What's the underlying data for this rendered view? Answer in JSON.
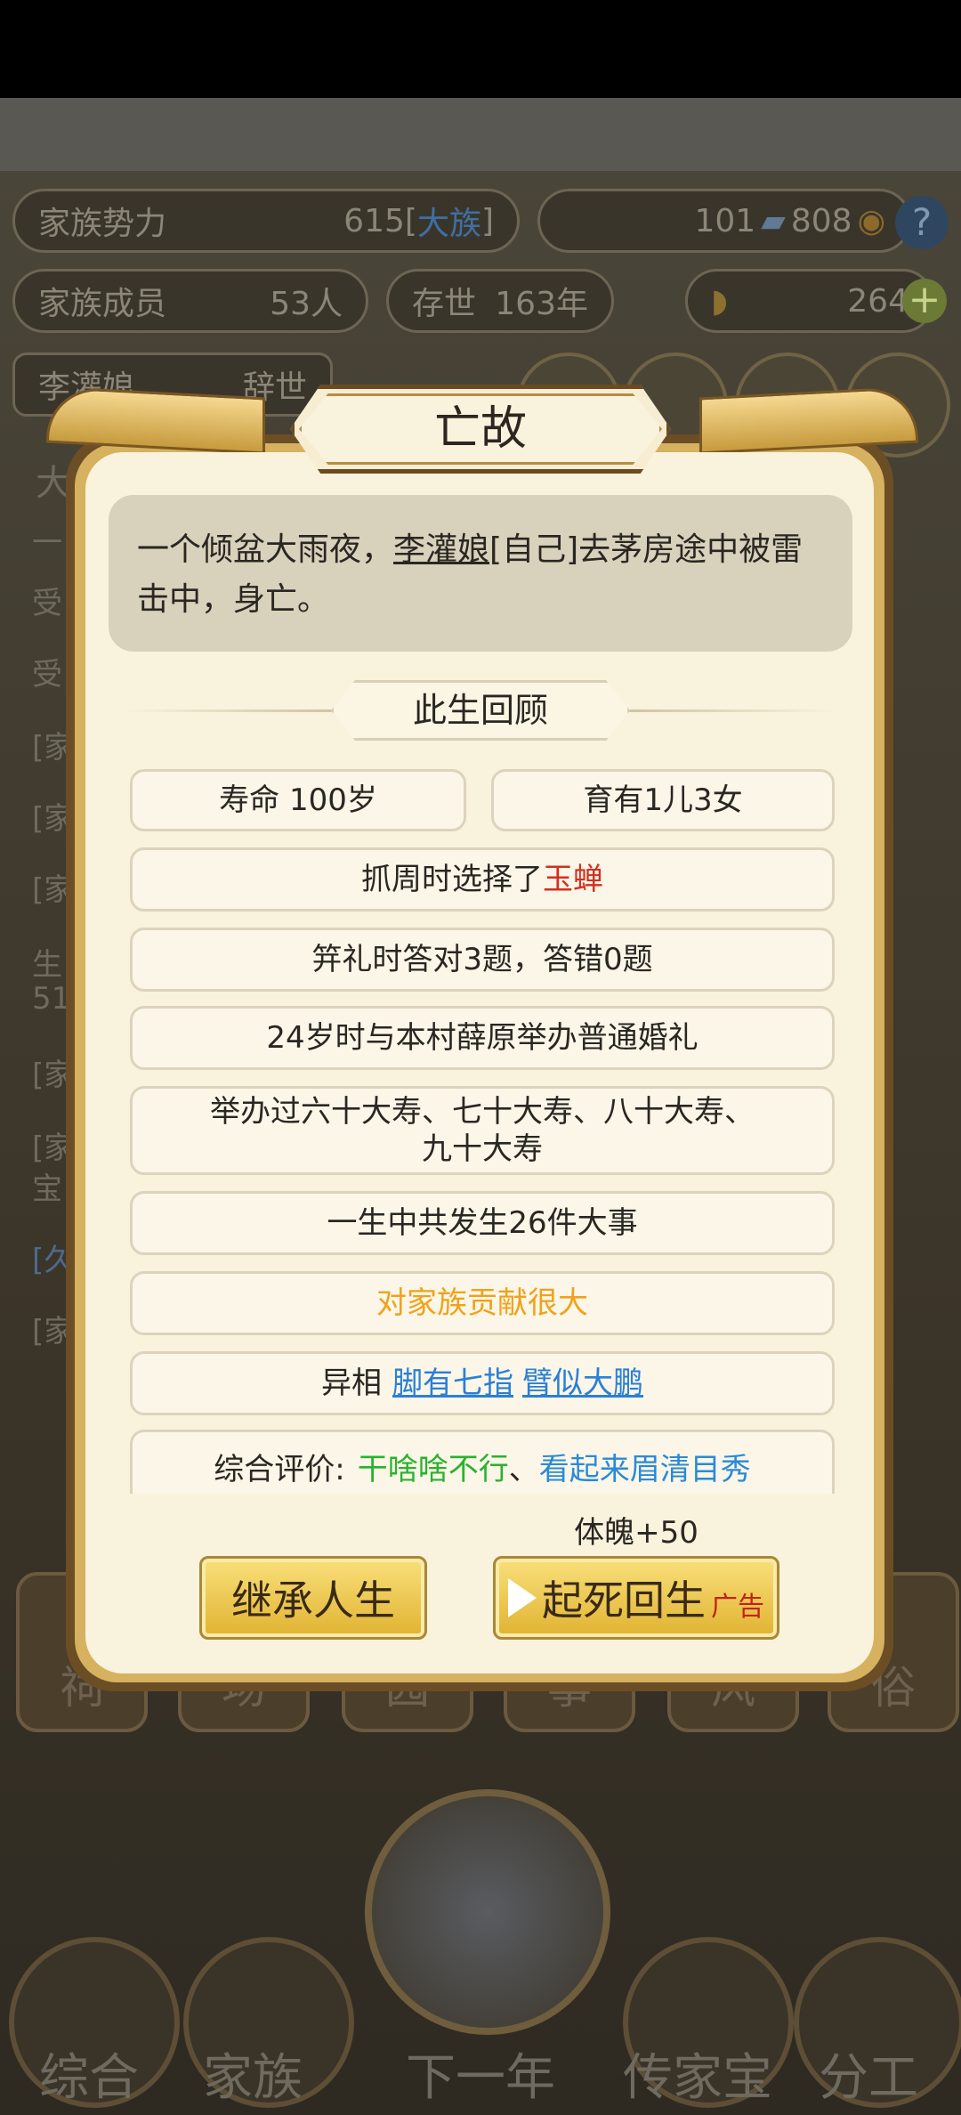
{
  "hud": {
    "power_label": "家族势力",
    "power_value": "615[",
    "power_rank": "大族",
    "power_close": "]",
    "currency1": "101",
    "currency2": "808",
    "help": "?",
    "members_label": "家族成员",
    "members_value": "53人",
    "alive_label": "存世",
    "alive_value": "163年",
    "gold_value": "264",
    "gold_add": "+",
    "person_name": "李灌娘",
    "person_status": "辞世"
  },
  "bg_log": [
    "大",
    "一",
    "受",
    "受",
    "[家",
    "[家",
    "[家",
    "生",
    "51",
    "[家",
    "[家",
    "宝",
    "[久",
    "[家"
  ],
  "tabs": [
    "祠",
    "场",
    "园",
    "事",
    "风",
    "俗"
  ],
  "nav": [
    "综合",
    "家族",
    "下一年",
    "传家宝",
    "分工"
  ],
  "dialog": {
    "title": "亡故",
    "story_pre": "一个倾盆大雨夜，",
    "story_name": "李灌娘",
    "story_post": "[自己]去茅房途中被雷击中，身亡。",
    "review_title": "此生回顾",
    "lifespan": "寿命 100岁",
    "children": "育有1儿3女",
    "zhuazhou_pre": "抓周时选择了",
    "zhuazhou_item": "玉蝉",
    "jili": "笄礼时答对3题，答错0题",
    "marriage": "24岁时与本村薛原举办普通婚礼",
    "birthdays_line1": "举办过六十大寿、七十大寿、八十大寿、",
    "birthdays_line2": "九十大寿",
    "events": "一生中共发生26件大事",
    "contribution": "对家族贡献很大",
    "traits_label": "异相",
    "trait1": "脚有七指",
    "trait2": "臂似大鹏",
    "eval_label": "综合评价:",
    "eval1": "干啥啥不行",
    "eval_sep": "、",
    "eval2": "看起来眉清目秀",
    "bonus": "体魄+50",
    "inherit_button": "继承人生",
    "revive_button": "起死回生",
    "ad_label": "广告"
  },
  "colors": {
    "accent_red": "#d42f1f",
    "accent_orange": "#f0a21a",
    "link_blue": "#2a7fd6",
    "good_green": "#28b32c",
    "button_gold": "#e0b331"
  }
}
